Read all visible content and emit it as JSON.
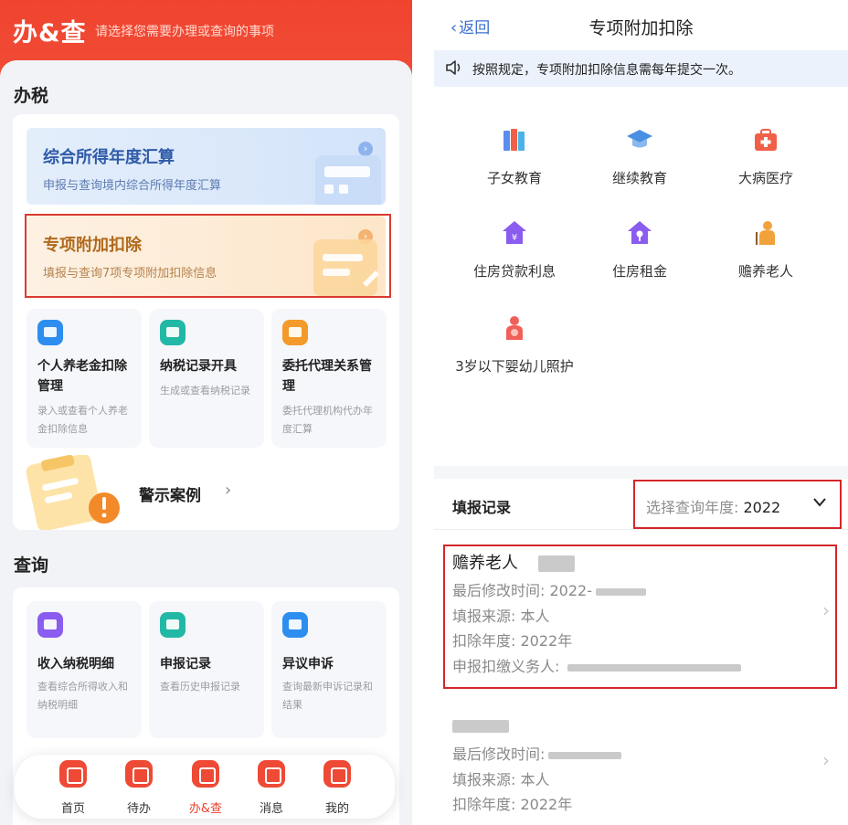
{
  "left": {
    "header": {
      "title": "办&查",
      "subtitle": "请选择您需要办理或查询的事项"
    },
    "tax_section": {
      "title": "办税"
    },
    "banners": [
      {
        "title": "综合所得年度汇算",
        "desc": "申报与查询境内综合所得年度汇算"
      },
      {
        "title": "专项附加扣除",
        "desc": "填报与查询7项专项附加扣除信息"
      }
    ],
    "services": [
      {
        "title": "个人养老金扣除管理",
        "desc": "录入或查看个人养老金扣除信息",
        "icon": "pension-icon",
        "color": "#2d8ef0"
      },
      {
        "title": "纳税记录开具",
        "desc": "生成或查看纳税记录",
        "icon": "tax-record-icon",
        "color": "#22b8a6"
      },
      {
        "title": "委托代理关系管理",
        "desc": "委托代理机构代办年度汇算",
        "icon": "agent-icon",
        "color": "#f39a2b"
      }
    ],
    "warning": {
      "label": "警示案例"
    },
    "query_section": {
      "title": "查询"
    },
    "queries": [
      {
        "title": "收入纳税明细",
        "desc": "查看综合所得收入和纳税明细",
        "icon": "income-icon",
        "color": "#8a5cf0"
      },
      {
        "title": "申报记录",
        "desc": "查看历史申报记录",
        "icon": "declare-record-icon",
        "color": "#22b8a6"
      },
      {
        "title": "异议申诉",
        "desc": "查询最新申诉记录和结果",
        "icon": "appeal-icon",
        "color": "#2d8ef0"
      }
    ],
    "nav": [
      {
        "label": "首页",
        "icon": "home-icon"
      },
      {
        "label": "待办",
        "icon": "todo-icon"
      },
      {
        "label": "办&查",
        "icon": "handle-query-icon"
      },
      {
        "label": "消息",
        "icon": "message-icon"
      },
      {
        "label": "我的",
        "icon": "profile-icon"
      }
    ]
  },
  "right": {
    "back_label": "返回",
    "title": "专项附加扣除",
    "notice": "按照规定，专项附加扣除信息需每年提交一次。",
    "categories": [
      {
        "label": "子女教育",
        "icon": "books-icon",
        "color": "#5b8def"
      },
      {
        "label": "继续教育",
        "icon": "graduation-cap-icon",
        "color": "#4a90e2"
      },
      {
        "label": "大病医疗",
        "icon": "medical-kit-icon",
        "color": "#f06048"
      },
      {
        "label": "住房贷款利息",
        "icon": "house-yuan-icon",
        "color": "#8a5cf0"
      },
      {
        "label": "住房租金",
        "icon": "house-key-icon",
        "color": "#8a5cf0"
      },
      {
        "label": "赡养老人",
        "icon": "elder-icon",
        "color": "#f2a23a"
      },
      {
        "label": "3岁以下婴幼儿照护",
        "icon": "baby-care-icon",
        "color": "#f0605a"
      }
    ],
    "records": {
      "title": "填报记录",
      "year_select_label": "选择查询年度:",
      "year_value": "2022",
      "items": [
        {
          "name": "赡养老人",
          "modified": "最后修改时间: 2022-",
          "source": "填报来源: 本人",
          "year": "扣除年度: 2022年",
          "agent": "申报扣缴义务人: "
        },
        {
          "name": "",
          "modified": "最后修改时间:",
          "source": "填报来源: 本人",
          "year": "扣除年度: 2022年"
        }
      ]
    }
  }
}
